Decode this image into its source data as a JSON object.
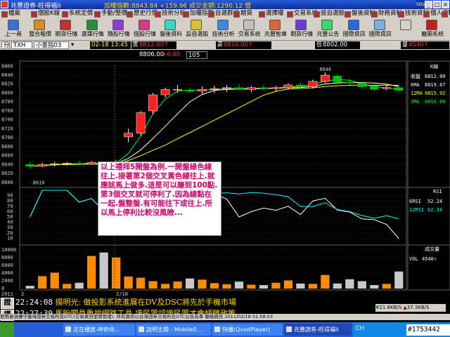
{
  "window": {
    "title": "兆豐證券-旺得福II",
    "index_text": "加權指數:8843.84   +159.96  成交金額:1290.12   億",
    "buttons": [
      "_",
      "□",
      "×"
    ],
    "logo": "SOUND"
  },
  "menu": [
    "檔案",
    "個股K線",
    "系統定價",
    "手動/整價",
    "歷史行情",
    "技術分析",
    "加權指數",
    "自選群組",
    "期貨",
    "選擇權",
    "交易系統",
    "設自選股",
    "盤後資料",
    "財務資料",
    "技術資料",
    "個人資料",
    "客戶服務"
  ],
  "toolbar": [
    "上一頁",
    "整合報價",
    "期貨行情",
    "選擇行情",
    "類股行情",
    "個股行情",
    "盤後資料",
    "設自選股",
    "技術分析",
    "交易系統",
    "兆豐智庫",
    "期貨行情",
    "兆豐公告",
    "國際資訊",
    "國際資訊",
    "",
    "離開系統"
  ],
  "quote": {
    "tab": "分",
    "symbol": "TXH",
    "name": "小臺指03",
    "time": "02-18 13:45",
    "open_label": "開",
    "open": "8812.00↑",
    "high_label": "高",
    "high": "8816.00↑",
    "low_label": "低",
    "low": "8802.00",
    "vol_label": "量",
    "vol": "4540↑",
    "prev": "8806.00",
    "change": "+6.00",
    "period": "105"
  },
  "chart_data": [
    {
      "type": "candlestick",
      "title": "K線",
      "yticks": [
        8600,
        8620,
        8640,
        8660,
        8680,
        8700,
        8720,
        8740,
        8760,
        8780,
        8800,
        8820,
        8840,
        8860
      ],
      "ylim": [
        8595,
        8862
      ],
      "candles": [
        [
          8640,
          8646,
          8630,
          8636
        ],
        [
          8636,
          8644,
          8634,
          8640
        ],
        [
          8640,
          8646,
          8636,
          8642
        ],
        [
          8642,
          8646,
          8638,
          8643
        ],
        [
          8643,
          8648,
          8638,
          8641
        ],
        [
          8641,
          8648,
          8640,
          8645
        ],
        [
          8642,
          8648,
          8638,
          8640
        ],
        [
          8640,
          8650,
          8636,
          8644
        ],
        [
          8702,
          8720,
          8690,
          8710
        ],
        [
          8710,
          8760,
          8705,
          8756
        ],
        [
          8760,
          8800,
          8752,
          8796
        ],
        [
          8796,
          8812,
          8790,
          8808
        ],
        [
          8808,
          8818,
          8800,
          8808
        ],
        [
          8806,
          8812,
          8800,
          8804
        ],
        [
          8804,
          8815,
          8798,
          8808
        ],
        [
          8808,
          8816,
          8800,
          8810
        ],
        [
          8810,
          8818,
          8802,
          8812
        ],
        [
          8812,
          8820,
          8806,
          8808
        ],
        [
          8808,
          8816,
          8802,
          8812
        ],
        [
          8812,
          8818,
          8806,
          8810
        ],
        [
          8810,
          8816,
          8804,
          8812
        ],
        [
          8812,
          8822,
          8808,
          8818
        ],
        [
          8818,
          8824,
          8810,
          8814
        ],
        [
          8814,
          8830,
          8810,
          8826
        ],
        [
          8826,
          8846,
          8822,
          8840
        ],
        [
          8838,
          8842,
          8820,
          8824
        ],
        [
          8824,
          8830,
          8818,
          8822
        ],
        [
          8822,
          8826,
          8810,
          8814
        ],
        [
          8816,
          8822,
          8804,
          8808
        ],
        [
          8810,
          8818,
          8806,
          8812
        ],
        [
          8812,
          8816,
          8804,
          8806
        ]
      ],
      "high_mark": "8846",
      "low_mark": "8610",
      "legend": [
        {
          "label": "收盤",
          "value": "8812.00",
          "color": "#ffffff"
        },
        {
          "label": "6MA",
          "value": "8819.67",
          "color": "#ffffff"
        },
        {
          "label": "12MA",
          "value": "8815.92",
          "color": "#ffff00"
        },
        {
          "label": "3MA",
          "value": "8810.00",
          "color": "#00ff00"
        }
      ]
    },
    {
      "type": "line",
      "title": "RSI",
      "yticks": [
        90,
        80,
        70,
        60,
        50,
        40,
        30,
        20,
        10
      ],
      "legend": [
        {
          "label": "6RSI",
          "value": "52.24",
          "color": "#ffffff"
        },
        {
          "label": "12RSI",
          "value": "62.34",
          "color": "#00ffff"
        }
      ]
    },
    {
      "type": "bar",
      "title": "成交量",
      "yticks": [
        10000,
        8000,
        6000,
        4000,
        2000,
        0
      ],
      "ylim": [
        0,
        10500
      ],
      "values": [
        700,
        3200,
        4100,
        1200,
        1500,
        8400,
        9300,
        8000,
        3100,
        2800,
        1900,
        1200,
        1800,
        2600,
        2300,
        1400,
        1100,
        1800,
        1000,
        900,
        1500,
        2100,
        1300,
        1200,
        3500,
        1300,
        2400,
        1900,
        900,
        1200,
        4400
      ],
      "legend": [
        {
          "label": "VOL",
          "value": "4540↑",
          "color": "#ffffff"
        }
      ]
    }
  ],
  "xaxis": {
    "year": "2011",
    "day1": "2",
    "day2": "2/18"
  },
  "annotation": "以上禮拜5開盤為例.一開盤綠色線往上.接著第2個交叉黃色線往上.就應該馬上做多.這是可以賺到100點.第3個交叉就可停利了.因為線黏在一起.盤整盤.有可能往下或往上.所以馬上停利比較沒風險...",
  "news": [
    {
      "button": "證",
      "time": "22:24:08",
      "text": "揚明光: 做投影系統進展在DV及DSC將先於手機市場"
    },
    {
      "button": "權",
      "time": "22:27:39",
      "text": "馬盼閣員重視網路工具 讓民眾認識民眾才會傾聽政策"
    }
  ],
  "speed": {
    "down": "21.8KB/S",
    "up": "37.3KB/S"
  },
  "status_line": "使用者須遵守臺灣證券交易所及OTC(交易資訊使用管理), 所有資訊以台灣證券交易所及OTC公告為準   聯絡資訊  2011/02/18  01:58:03",
  "taskbar": {
    "tasks": [
      "正在播放-神奇侍...",
      "說明主題 - Mobile0...",
      "快播(QvodPlayer)",
      "兆豐證券-旺得福II"
    ],
    "lang": "CH",
    "clock": "",
    "watermark": "#1753442"
  },
  "colors": {
    "up": "#ff2020",
    "down": "#00c000",
    "bg": "#000000",
    "grid": "#404040"
  }
}
